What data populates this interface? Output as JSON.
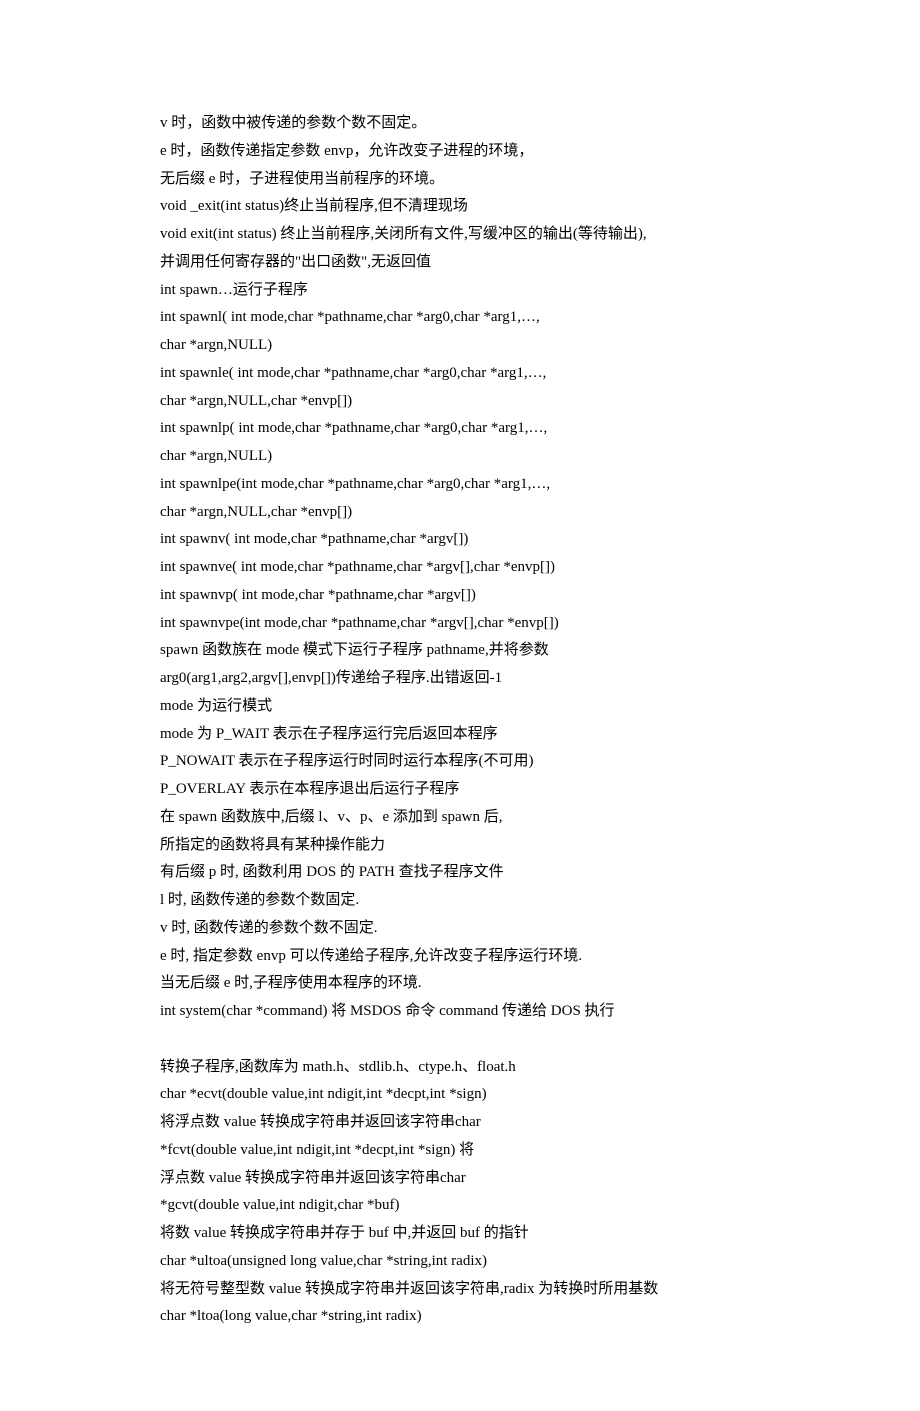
{
  "lines": [
    "v 时，函数中被传递的参数个数不固定。",
    "e 时，函数传递指定参数 envp，允许改变子进程的环境，",
    "无后缀 e 时，子进程使用当前程序的环境。",
    "void _exit(int status)终止当前程序,但不清理现场",
    "void exit(int status) 终止当前程序,关闭所有文件,写缓冲区的输出(等待输出),",
    "并调用任何寄存器的\"出口函数\",无返回值",
    "int spawn…运行子程序",
    "int spawnl( int mode,char *pathname,char *arg0,char *arg1,…,",
    "char *argn,NULL)",
    "int spawnle( int mode,char *pathname,char *arg0,char *arg1,…,",
    "char *argn,NULL,char *envp[])",
    "int spawnlp( int mode,char *pathname,char *arg0,char *arg1,…,",
    "char *argn,NULL)",
    "int spawnlpe(int mode,char *pathname,char *arg0,char *arg1,…,",
    "char *argn,NULL,char *envp[])",
    "int spawnv( int mode,char *pathname,char *argv[])",
    "int spawnve( int mode,char *pathname,char *argv[],char *envp[])",
    "int spawnvp( int mode,char *pathname,char *argv[])",
    "int spawnvpe(int mode,char *pathname,char *argv[],char *envp[])",
    "spawn 函数族在 mode 模式下运行子程序 pathname,并将参数",
    "arg0(arg1,arg2,argv[],envp[])传递给子程序.出错返回-1",
    "mode 为运行模式",
    "mode 为 P_WAIT 表示在子程序运行完后返回本程序",
    "P_NOWAIT 表示在子程序运行时同时运行本程序(不可用)",
    "P_OVERLAY 表示在本程序退出后运行子程序",
    "在 spawn 函数族中,后缀 l、v、p、e 添加到 spawn 后,",
    "所指定的函数将具有某种操作能力",
    "有后缀 p 时, 函数利用 DOS 的 PATH 查找子程序文件",
    "l 时, 函数传递的参数个数固定.",
    "v 时, 函数传递的参数个数不固定.",
    "e 时, 指定参数 envp 可以传递给子程序,允许改变子程序运行环境.",
    "当无后缀 e 时,子程序使用本程序的环境.",
    "int system(char *command) 将 MSDOS 命令 command 传递给 DOS 执行",
    "",
    "转换子程序,函数库为 math.h、stdlib.h、ctype.h、float.h",
    "char *ecvt(double value,int ndigit,int *decpt,int *sign)",
    "将浮点数 value 转换成字符串并返回该字符串char",
    "*fcvt(double value,int ndigit,int *decpt,int *sign) 将",
    "浮点数 value 转换成字符串并返回该字符串char",
    "*gcvt(double value,int ndigit,char *buf)",
    "将数 value 转换成字符串并存于 buf 中,并返回 buf 的指针",
    "char *ultoa(unsigned long value,char *string,int radix)",
    "将无符号整型数 value 转换成字符串并返回该字符串,radix 为转换时所用基数",
    "char *ltoa(long value,char *string,int radix)"
  ]
}
